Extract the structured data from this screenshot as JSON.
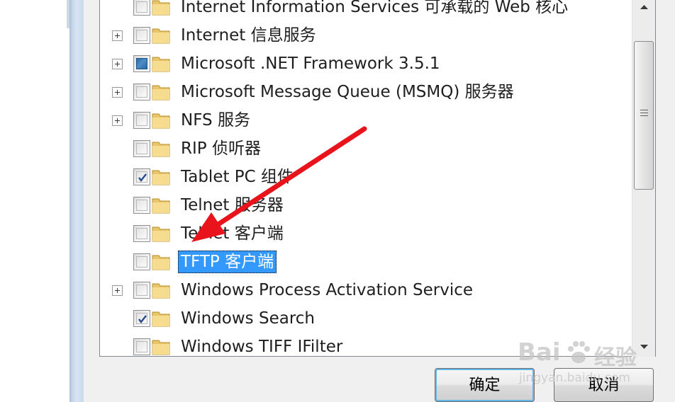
{
  "features_tree": {
    "items": [
      {
        "label": "Internet Information Services 可承载的 Web 核心",
        "expandable": false,
        "state": "unchecked"
      },
      {
        "label": "Internet 信息服务",
        "expandable": true,
        "state": "unchecked"
      },
      {
        "label": "Microsoft .NET Framework 3.5.1",
        "expandable": true,
        "state": "partial"
      },
      {
        "label": "Microsoft Message Queue (MSMQ) 服务器",
        "expandable": true,
        "state": "unchecked"
      },
      {
        "label": "NFS 服务",
        "expandable": true,
        "state": "unchecked"
      },
      {
        "label": "RIP 侦听器",
        "expandable": false,
        "state": "unchecked"
      },
      {
        "label": "Tablet PC 组件",
        "expandable": false,
        "state": "checked"
      },
      {
        "label": "Telnet 服务器",
        "expandable": false,
        "state": "unchecked"
      },
      {
        "label": "Telnet 客户端",
        "expandable": false,
        "state": "unchecked"
      },
      {
        "label": "TFTP 客户端",
        "expandable": false,
        "state": "unchecked",
        "selected": true
      },
      {
        "label": "Windows Process Activation Service",
        "expandable": true,
        "state": "unchecked"
      },
      {
        "label": "Windows Search",
        "expandable": false,
        "state": "checked"
      },
      {
        "label": "Windows TIFF IFilter",
        "expandable": false,
        "state": "unchecked"
      }
    ]
  },
  "buttons": {
    "ok_label": "确定",
    "cancel_label": "取消"
  },
  "watermark": {
    "brand": "Bai",
    "brand_suffix": "经验",
    "url": "jingyan.baidu.com"
  },
  "colors": {
    "selection": "#3399ff",
    "annotation_arrow": "#e8131b",
    "partial_check": "#2a6aa8"
  }
}
